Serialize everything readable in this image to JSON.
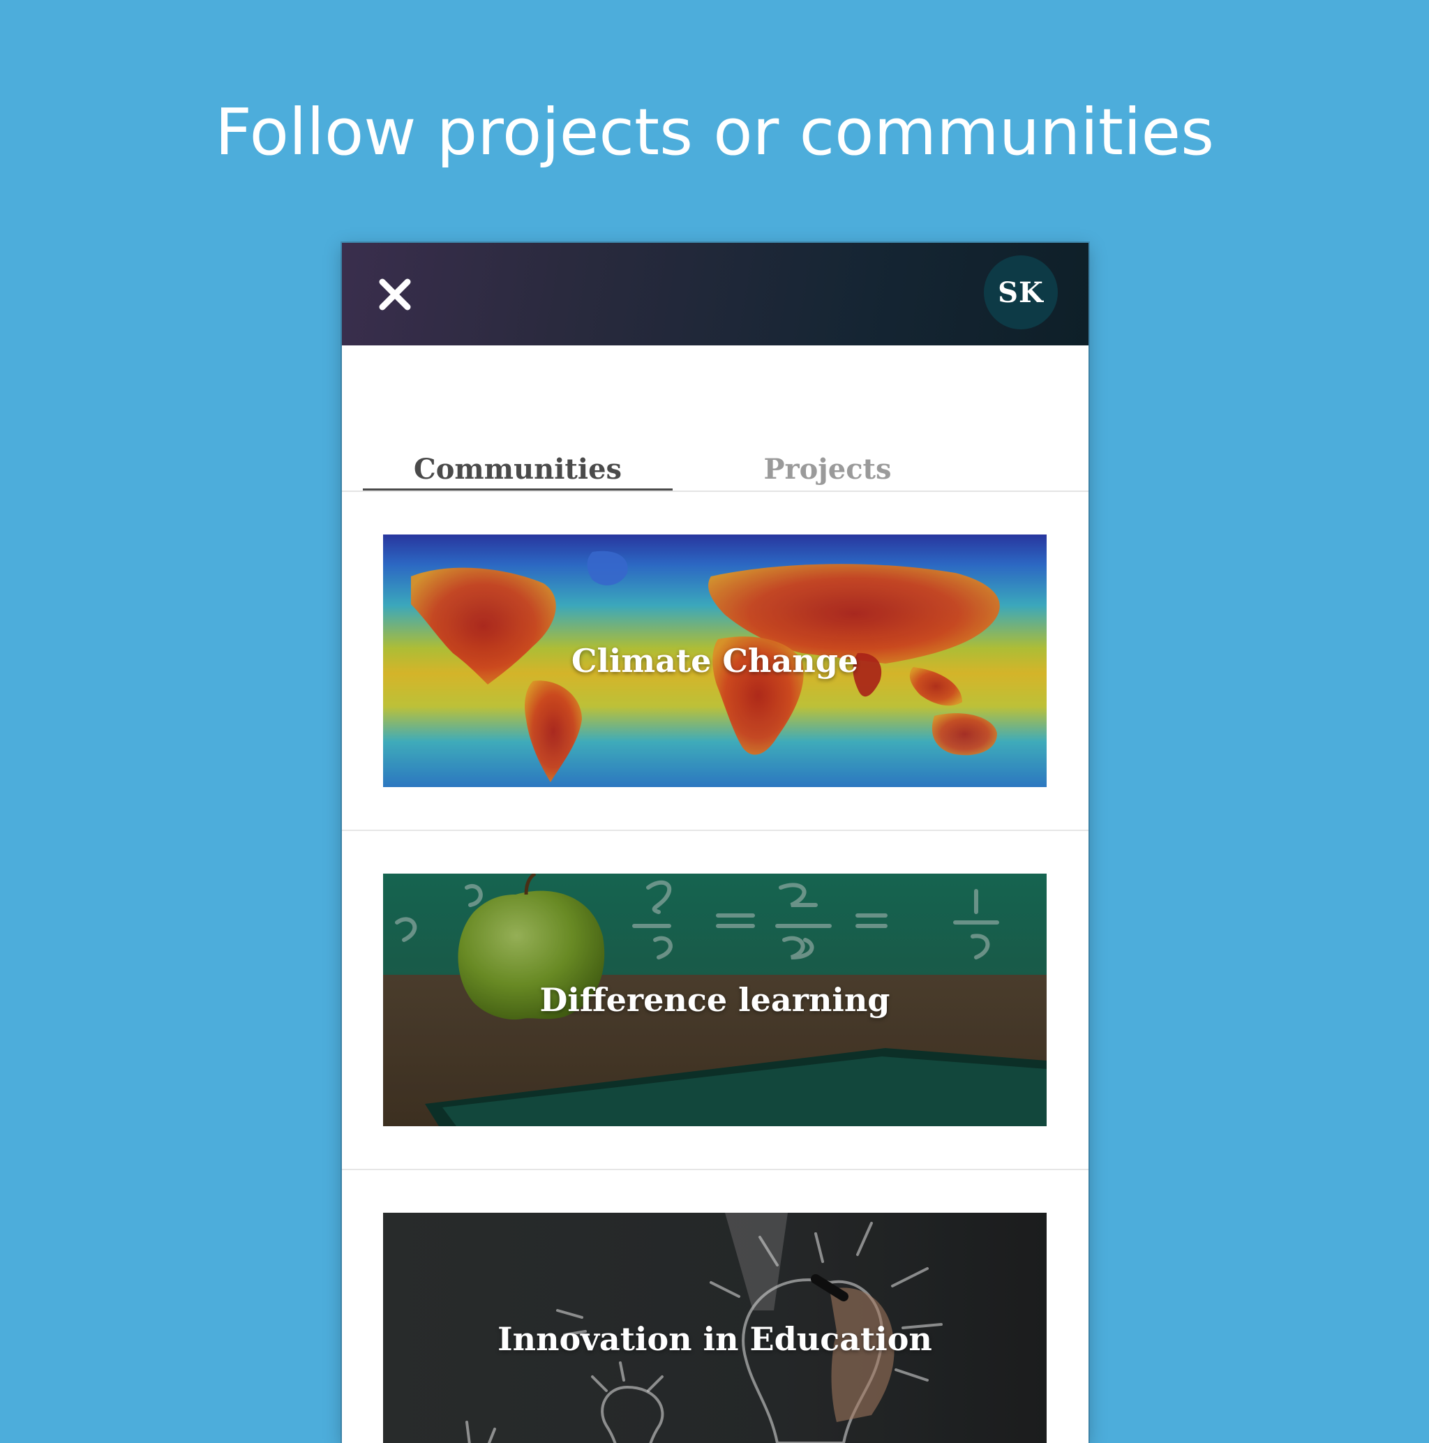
{
  "headline": "Follow projects or communities",
  "header": {
    "close_icon": "close-icon",
    "avatar_initials": "SK"
  },
  "tabs": [
    {
      "label": "Communities",
      "active": true
    },
    {
      "label": "Projects",
      "active": false
    }
  ],
  "communities": [
    {
      "title": "Climate Change",
      "image": "world-heat-map"
    },
    {
      "title": "Difference learning",
      "image": "apple-on-desk-chalkboard"
    },
    {
      "title": "Innovation in Education",
      "image": "lightbulb-sketch"
    }
  ],
  "colors": {
    "background": "#4daddb",
    "header_start": "#3a2e4d",
    "header_end": "#0e1f28",
    "avatar": "#0d3a46",
    "tab_active": "#4a4a4a",
    "tab_inactive": "#9a9a9a"
  }
}
